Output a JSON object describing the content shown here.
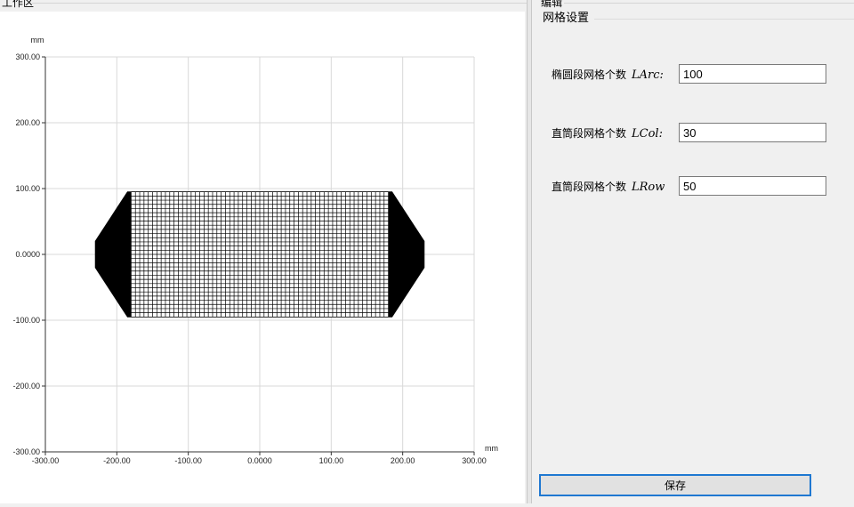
{
  "workspace": {
    "title": "工作区"
  },
  "editor": {
    "title": "编辑",
    "group_title": "网格设置",
    "fields": [
      {
        "label": "椭圆段网格个数",
        "var": "LArc:",
        "value": "100"
      },
      {
        "label": "直筒段网格个数",
        "var": "LCol:",
        "value": "30"
      },
      {
        "label": "直筒段网格个数",
        "var": "LRow",
        "value": "50"
      }
    ],
    "save_label": "保存"
  },
  "chart_data": {
    "type": "scatter",
    "xlabel": "mm",
    "ylabel": "mm",
    "xlim": [
      -300,
      300
    ],
    "ylim": [
      -300,
      300
    ],
    "x_ticks": [
      -300,
      -200,
      -100,
      0,
      100,
      200,
      300
    ],
    "y_ticks": [
      -300,
      -200,
      -100,
      0,
      100,
      200,
      300
    ],
    "x_tick_labels": [
      "-300.00",
      "-200.00",
      "-100.00",
      "0.0000",
      "100.00",
      "200.00",
      "300.00"
    ],
    "y_tick_labels": [
      "-300.00",
      "-200.00",
      "-100.00",
      "0.0000",
      "100.00",
      "200.00",
      "300.00"
    ],
    "grid": true,
    "mesh": {
      "outline": [
        [
          -230,
          20
        ],
        [
          -185,
          95
        ],
        [
          185,
          95
        ],
        [
          230,
          20
        ],
        [
          230,
          -20
        ],
        [
          185,
          -95
        ],
        [
          -185,
          -95
        ],
        [
          -230,
          -20
        ]
      ],
      "column_x_range": [
        -180,
        180
      ],
      "row_y_range": [
        -95,
        95
      ],
      "columns": 60,
      "rows": 30,
      "color": "#000000"
    }
  }
}
